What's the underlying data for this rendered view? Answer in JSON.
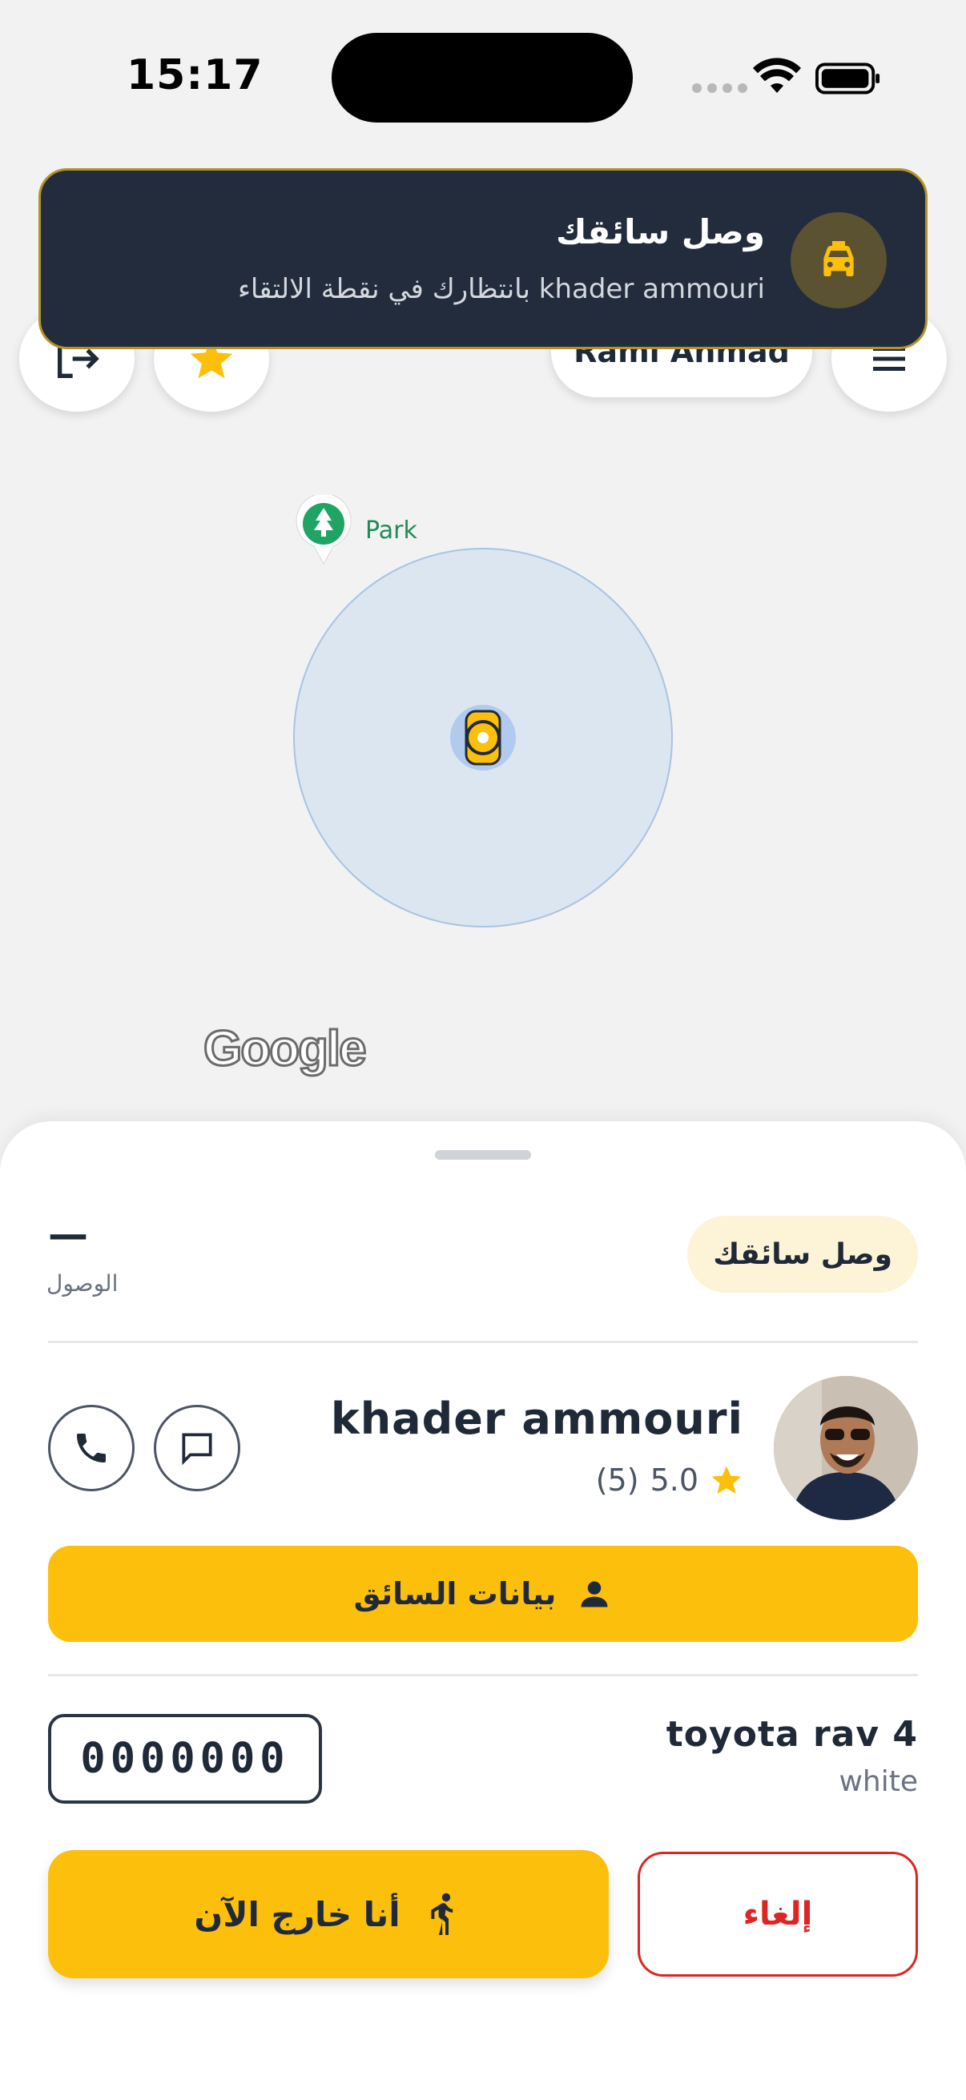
{
  "status_bar": {
    "time": "15:17"
  },
  "map": {
    "user_name": "Rami Ahmad",
    "poi_label": "Park",
    "attribution": "Google"
  },
  "notification": {
    "title": "وصل سائقك",
    "body": "khader ammouri بانتظارك في نقطة الالتقاء",
    "icon": "taxi-icon"
  },
  "sheet": {
    "status_label": "وصل سائقك",
    "eta_value": "—",
    "eta_label": "الوصول",
    "driver": {
      "name": "khader ammouri",
      "rating": "5.0",
      "rating_count": "(5)"
    },
    "driver_info_label": "بيانات السائق",
    "car": {
      "model": "toyota rav 4",
      "color": "white",
      "plate": "0000000"
    },
    "actions": {
      "outside_label": "أنا خارج الآن",
      "cancel_label": "إلغاء"
    }
  },
  "colors": {
    "accent": "#fbbf0c",
    "notification_bg": "#222c3c",
    "danger": "#dc2626"
  }
}
